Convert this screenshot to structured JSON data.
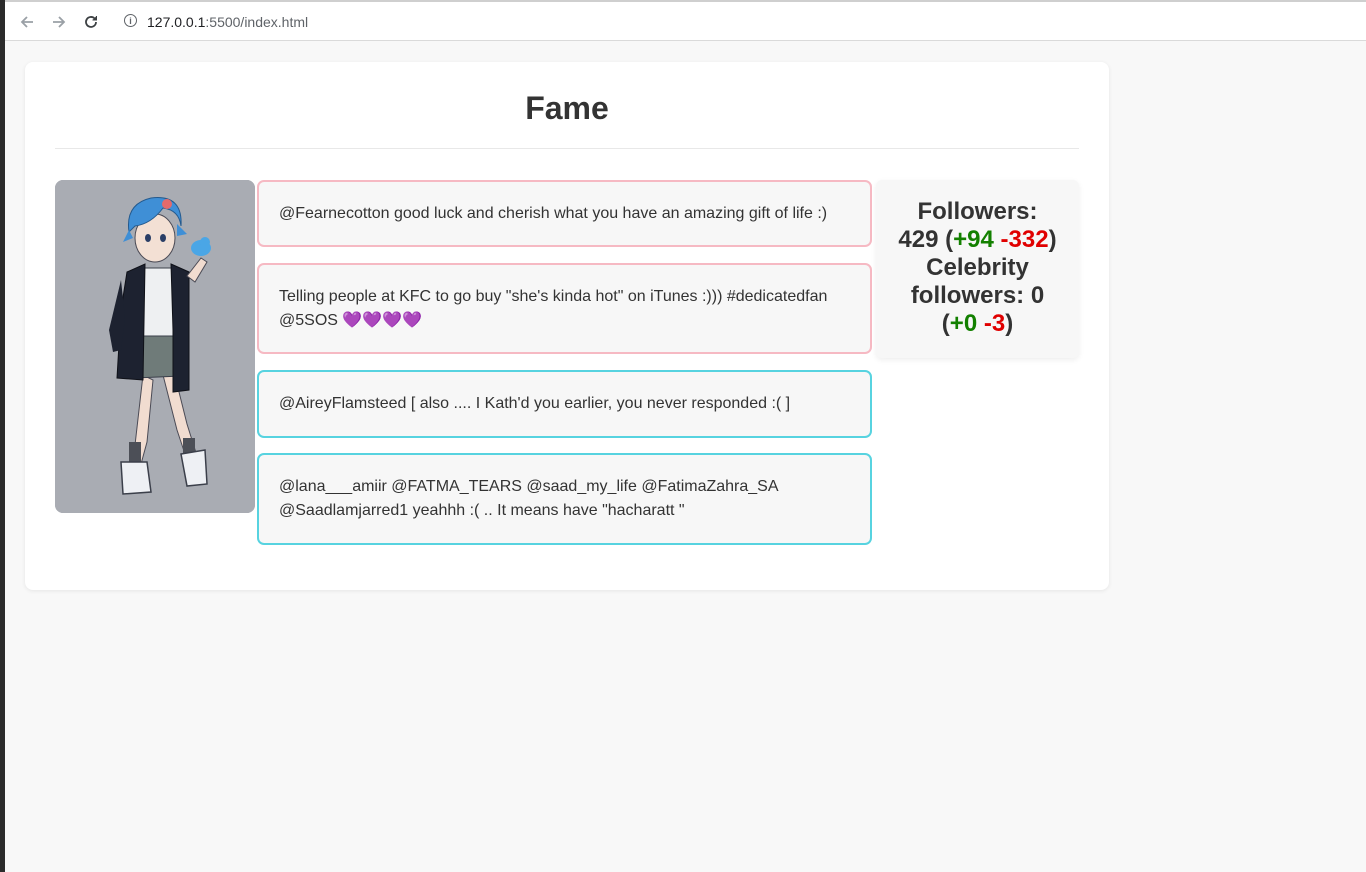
{
  "browser": {
    "url_host": "127.0.0.1",
    "url_rest": ":5500/index.html"
  },
  "page": {
    "title": "Fame"
  },
  "tweets": [
    {
      "text": "@Fearnecotton good luck and cherish what you have an amazing gift of life :)",
      "border_color": "#f6b9c3"
    },
    {
      "text": "Telling people at KFC to go buy \"she's kinda hot\" on iTunes :))) #dedicatedfan @5SOS 💜💜💜💜",
      "border_color": "#f6b9c3"
    },
    {
      "text": "@AireyFlamsteed [ also .... I Kath'd you earlier, you never responded :( ]",
      "border_color": "#57d3e0"
    },
    {
      "text": "@lana___amiir @FATMA_TEARS @saad_my_life @FatimaZahra_SA @Saadlamjarred1 yeahhh :( .. It means have \"hacharatt \"",
      "border_color": "#57d3e0"
    }
  ],
  "stats": {
    "followers_label": "Followers:",
    "followers_count": "429",
    "followers_gain": "+94",
    "followers_loss": "-332",
    "celebrity_label": "Celebrity followers:",
    "celebrity_count": "0",
    "celebrity_gain": "+0",
    "celebrity_loss": "-3",
    "gain_color": "#138000",
    "loss_color": "#e00000"
  }
}
